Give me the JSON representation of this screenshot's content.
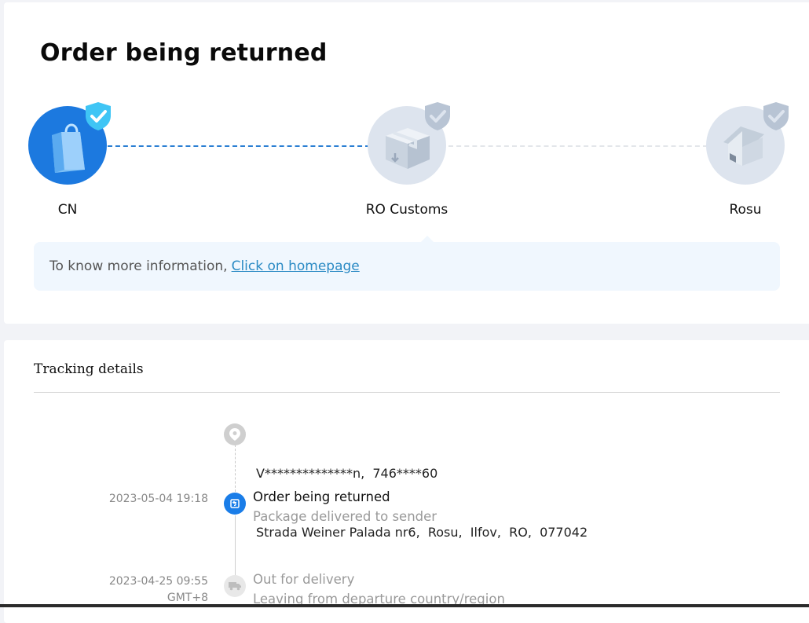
{
  "header": {
    "title": "Order being returned"
  },
  "progress": {
    "steps": [
      {
        "label": "CN",
        "status": "completed",
        "icon": "shopping-bag-icon"
      },
      {
        "label": "RO Customs",
        "status": "pending",
        "icon": "package-box-icon"
      },
      {
        "label": "Rosu",
        "status": "pending",
        "icon": "house-icon"
      }
    ],
    "colors": {
      "active": "#1c79df",
      "inactive": "#dde4ee",
      "check_active": "#3fc5f5",
      "check_inactive": "#b8c4d4"
    }
  },
  "info_banner": {
    "text": "To know more information,",
    "link_text": "Click on homepage"
  },
  "tracking": {
    "section_title": "Tracking details",
    "address": {
      "line1": "V**************n,  746****60",
      "line2": "Strada Weiner Palada nr6,  Rosu,  Ilfov,  RO,  077042"
    },
    "events": [
      {
        "date": "2023-05-04 19:18",
        "timezone": "",
        "status": "Order being returned",
        "description": "Package delivered to sender",
        "icon": "return-icon"
      },
      {
        "date": "2023-04-25 09:55",
        "timezone": "GMT+8",
        "status": "Out for delivery",
        "description": "Leaving from departure country/region",
        "icon": "truck-icon"
      }
    ]
  }
}
